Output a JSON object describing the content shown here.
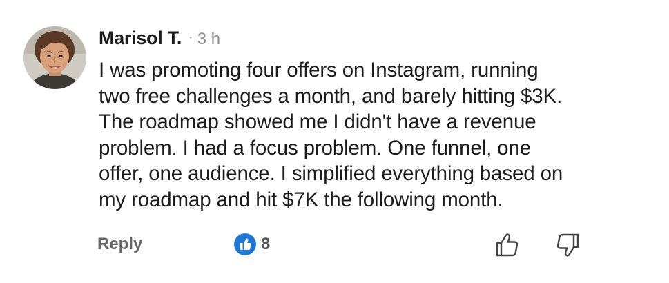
{
  "comment": {
    "author": "Marisol T.",
    "separator": "·",
    "timestamp": "3 h",
    "avatar": {
      "description_icon": "person-avatar"
    },
    "body_lines": [
      "I was promoting four offers on Instagram, running",
      "two free challenges a month, and barely hitting $3K.",
      "The roadmap showed me I didn't have a revenue",
      "problem. I had a focus problem. One funnel, one",
      "offer, one audience. I simplified everything based on",
      "my roadmap and hit $7K the following month."
    ]
  },
  "actions": {
    "reply_label": "Reply",
    "like_count": "8",
    "like_icon": "thumbs-up-filled-icon",
    "upvote_icon": "thumbs-up-outline-icon",
    "downvote_icon": "thumbs-down-outline-icon"
  },
  "colors": {
    "like_badge": "#1f78d4",
    "text": "#1c1c1c",
    "muted": "#8c8c8c",
    "action_text": "#666666"
  }
}
